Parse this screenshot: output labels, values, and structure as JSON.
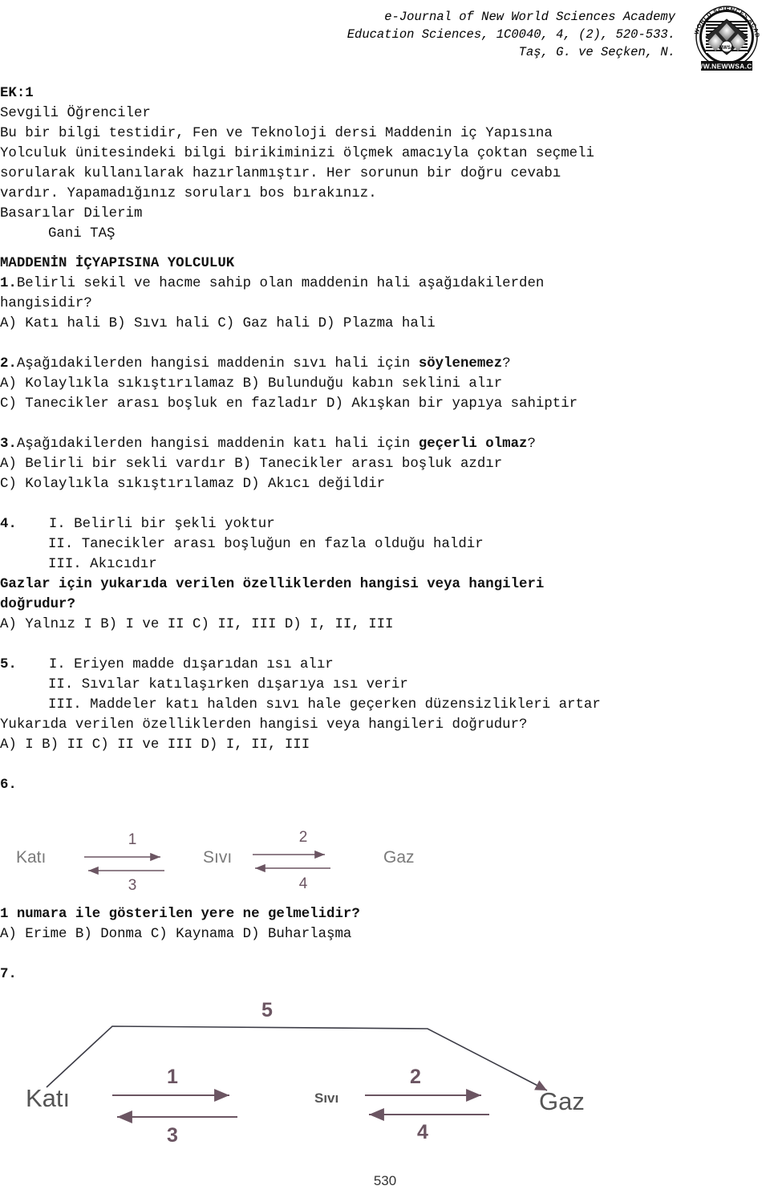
{
  "header": {
    "journal_line1": "e-Journal of New World Sciences Academy",
    "journal_line2": "Education Sciences, 1C0040, 4, (2), 520-533.",
    "authors": "Taş, G. ve Seçken, N.",
    "logo_name": "nwsa-seal-logo",
    "logo_outer_text": "NEW WORLD SCIENCES ACADEMY",
    "logo_url_text": "WWW.NEWWSA.COM"
  },
  "appendix": {
    "label": "EK:1",
    "salutation": "Sevgili Öğrenciler",
    "intro_lines": [
      "Bu bir bilgi testidir, Fen ve Teknoloji dersi Maddenin iç Yapısına",
      "Yolculuk ünitesindeki bilgi birikiminizi ölçmek amacıyla çoktan seçmeli",
      "sorularak kullanılarak hazırlanmıştır. Her sorunun bir doğru cevabı",
      "vardır. Yapamadığınız soruları bos bırakınız."
    ],
    "closing": "Basarılar Dilerim",
    "signature": "Gani TAŞ"
  },
  "test": {
    "title": "MADDENİN İÇYAPISINA YOLCULUK",
    "questions": [
      {
        "number": "1.",
        "stem_lines": [
          "Belirli sekil ve hacme sahip olan maddenin hali aşağıdakilerden",
          "hangisidir?"
        ],
        "options_lines": [
          "A) Katı hali B) Sıvı hali C) Gaz hali D) Plazma hali"
        ]
      },
      {
        "number": "2.",
        "stem_prefix": "Aşağıdakilerden hangisi maddenin sıvı hali için ",
        "stem_bold": "söylenemez",
        "stem_suffix": "?",
        "options_lines": [
          "A) Kolaylıkla sıkıştırılamaz B) Bulunduğu kabın seklini alır",
          "C) Tanecikler arası boşluk en fazladır D) Akışkan bir yapıya sahiptir"
        ]
      },
      {
        "number": "3.",
        "stem_prefix": "Aşağıdakilerden hangisi maddenin katı hali için ",
        "stem_bold": "geçerli olmaz",
        "stem_suffix": "?",
        "options_lines": [
          "A) Belirli bir sekli vardır B) Tanecikler arası boşluk azdır",
          "C) Kolaylıkla sıkıştırılamaz D) Akıcı değildir"
        ]
      },
      {
        "number": "4.",
        "roman_items": [
          "I. Belirli bir şekli yoktur",
          "II. Tanecikler arası boşluğun en fazla olduğu haldir",
          "III. Akıcıdır"
        ],
        "prompt_lines": [
          "Gazlar için yukarıda verilen özelliklerden hangisi veya hangileri",
          "doğrudur?"
        ],
        "options_lines": [
          "A) Yalnız I B) I ve II C) II, III D) I, II, III"
        ]
      },
      {
        "number": "5.",
        "roman_items": [
          "I. Eriyen madde dışarıdan ısı alır",
          "II. Sıvılar katılaşırken dışarıya ısı verir",
          "III. Maddeler katı halden sıvı hale geçerken düzensizlikleri artar"
        ],
        "prompt_lines": [
          "Yukarıda verilen özelliklerden hangisi veya hangileri doğrudur?"
        ],
        "options_lines": [
          "A) I B) II C) II ve III D) I, II, III"
        ]
      },
      {
        "number": "6.",
        "diagram": {
          "name": "state-change-diagram-1",
          "states": [
            "Katı",
            "Sıvı",
            "Gaz"
          ],
          "arrow_labels": [
            "1",
            "2",
            "3",
            "4"
          ],
          "arrow_color": "#6b5562"
        },
        "prompt_lines": [
          "1 numara ile gösterilen yere ne gelmelidir?"
        ],
        "options_lines": [
          "A) Erime B) Donma C) Kaynama D) Buharlaşma"
        ]
      },
      {
        "number": "7.",
        "diagram": {
          "name": "state-change-diagram-2",
          "states": [
            "Katı",
            "Sıvı",
            "Gaz"
          ],
          "arrow_labels": [
            "1",
            "2",
            "3",
            "4",
            "5"
          ],
          "arrow_color": "#6b5562"
        }
      }
    ]
  },
  "footer": {
    "page_number": "530"
  }
}
